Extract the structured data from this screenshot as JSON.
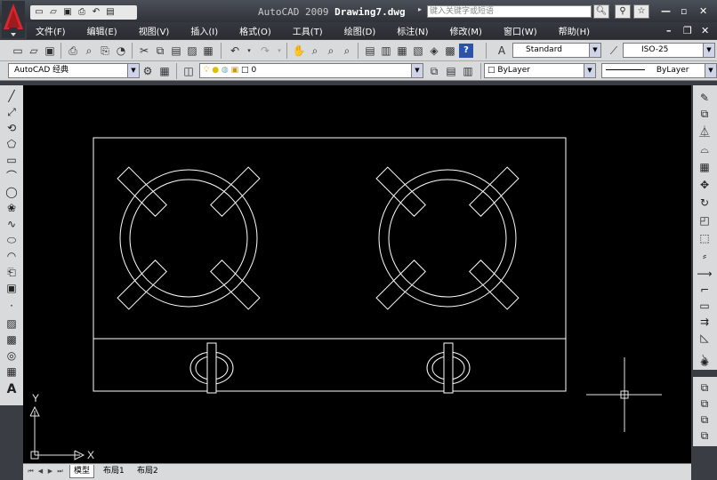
{
  "window": {
    "app": "AutoCAD 2009",
    "document": "Drawing7.dwg",
    "search_placeholder": "键入关键字或短语"
  },
  "menu": [
    "文件(F)",
    "编辑(E)",
    "视图(V)",
    "插入(I)",
    "格式(O)",
    "工具(T)",
    "绘图(D)",
    "标注(N)",
    "修改(M)",
    "窗口(W)",
    "帮助(H)"
  ],
  "toolbar": {
    "text_style": "Standard",
    "dim_style": "ISO-25",
    "workspace": "AutoCAD 经典",
    "layer": "0",
    "color": "ByLayer",
    "linetype": "ByLayer"
  },
  "canvas": {
    "background": "#000000",
    "line_color": "#ffffff",
    "ucs_x_label": "X",
    "ucs_y_label": "Y"
  },
  "tabs": [
    "模型",
    "布局1",
    "布局2"
  ],
  "active_tab": "模型",
  "icons": {
    "app_logo": "autocad-logo",
    "search": "search-icon",
    "exchange": "exchange-icon",
    "favorites": "star-icon"
  }
}
